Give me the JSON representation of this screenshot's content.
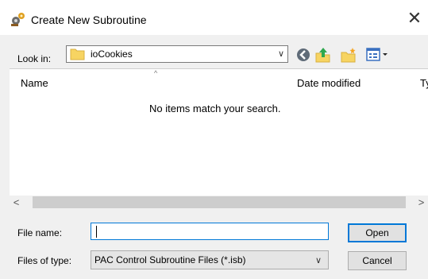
{
  "window": {
    "title": "Create New Subroutine",
    "close_label": "✕",
    "app_icon": "gear-cogs-icon"
  },
  "toolbar": {
    "look_in_label": "Look in:",
    "look_in_value": "ioCookies",
    "dropdown_glyph": "∨",
    "back_icon": "back-arrow-icon",
    "up_icon": "up-folder-icon",
    "new_folder_icon": "new-folder-icon",
    "view_icon": "view-menu-icon"
  },
  "file_list": {
    "columns": [
      "Name",
      "Date modified",
      "Ty"
    ],
    "sort_indicator": "^",
    "empty_message": "No items match your search."
  },
  "scrollbar": {
    "left_arrow": "<",
    "right_arrow": ">"
  },
  "form": {
    "file_name_label": "File name:",
    "file_name_value": "",
    "file_type_label": "Files of type:",
    "file_type_value": "PAC Control Subroutine Files (*.isb)",
    "dropdown_glyph": "∨"
  },
  "buttons": {
    "open": "Open",
    "cancel": "Cancel"
  },
  "colors": {
    "accent": "#0078d7",
    "dialog_background": "#f0f0f0",
    "folder_yellow": "#f7d462"
  }
}
